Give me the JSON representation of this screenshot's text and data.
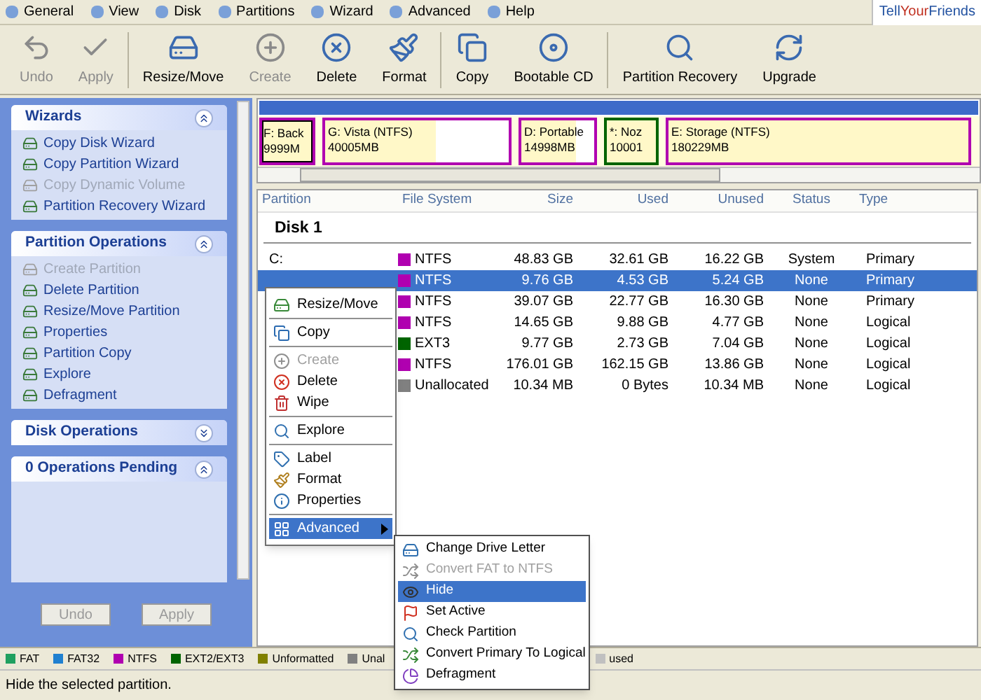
{
  "menu_bar": {
    "items": [
      "General",
      "View",
      "Disk",
      "Partitions",
      "Wizard",
      "Advanced",
      "Help"
    ],
    "link": [
      "Tell ",
      "Your ",
      "Friends"
    ]
  },
  "toolbar": {
    "groups": [
      [
        {
          "label": "Undo",
          "kind": "undo",
          "disabled": true
        },
        {
          "label": "Apply",
          "kind": "apply",
          "disabled": true
        }
      ],
      [
        {
          "label": "Resize/Move",
          "kind": "resize",
          "disabled": false
        },
        {
          "label": "Create",
          "kind": "create",
          "disabled": true
        },
        {
          "label": "Delete",
          "kind": "delete",
          "disabled": false
        },
        {
          "label": "Format",
          "kind": "format",
          "disabled": false
        }
      ],
      [
        {
          "label": "Copy",
          "kind": "copy",
          "disabled": false
        },
        {
          "label": "Bootable CD",
          "kind": "cd",
          "disabled": false
        }
      ],
      [
        {
          "label": "Partition Recovery",
          "kind": "recovery",
          "disabled": false
        },
        {
          "label": "Upgrade",
          "kind": "upgrade",
          "disabled": false
        }
      ]
    ]
  },
  "sidebar": {
    "panels": [
      {
        "title": "Wizards",
        "expanded": true,
        "items": [
          {
            "label": "Copy Disk Wizard",
            "disabled": false
          },
          {
            "label": "Copy Partition Wizard",
            "disabled": false
          },
          {
            "label": "Copy Dynamic Volume",
            "disabled": true
          },
          {
            "label": "Partition Recovery Wizard",
            "disabled": false
          }
        ]
      },
      {
        "title": "Partition Operations",
        "expanded": true,
        "items": [
          {
            "label": "Create Partition",
            "disabled": true
          },
          {
            "label": "Delete Partition",
            "disabled": false
          },
          {
            "label": "Resize/Move Partition",
            "disabled": false
          },
          {
            "label": "Properties",
            "disabled": false
          },
          {
            "label": "Partition Copy",
            "disabled": false
          },
          {
            "label": "Explore",
            "disabled": false
          },
          {
            "label": "Defragment",
            "disabled": false
          }
        ]
      },
      {
        "title": "Disk Operations",
        "expanded": false
      },
      {
        "title": "0 Operations Pending",
        "expanded": true
      }
    ],
    "buttons": [
      {
        "label": "Undo",
        "disabled": true
      },
      {
        "label": "Apply",
        "disabled": true
      }
    ]
  },
  "disk_map": {
    "partitions": [
      {
        "name": "F: Back",
        "size": "9999M",
        "color": "#b000b0",
        "selected": true,
        "level": 1
      },
      {
        "name": "G: Vista (NTFS)",
        "size": "40005MB",
        "color": "#b000b0",
        "selected": false,
        "level": 0.6
      },
      {
        "name": "D: Portable",
        "size": "14998MB",
        "color": "#b000b0",
        "selected": false,
        "level": 0.75
      },
      {
        "name": "*: Noz",
        "size": "10001",
        "color": "#006400",
        "selected": false,
        "level": 1
      },
      {
        "name": "E: Storage (NTFS)",
        "size": "180229MB",
        "color": "#b000b0",
        "selected": false,
        "level": 1
      }
    ]
  },
  "table": {
    "columns": [
      "Partition",
      "File System",
      "Size",
      "Used",
      "Unused",
      "Status",
      "Type"
    ],
    "group": "Disk 1",
    "rows": [
      {
        "partition": "C:",
        "file_system": "NTFS",
        "color": "#b000b0",
        "size": "48.83 GB",
        "used": "32.61 GB",
        "unused": "16.22 GB",
        "status": "System",
        "type": "Primary",
        "selected": false
      },
      {
        "file_system": "NTFS",
        "color": "#b000b0",
        "size": "9.76 GB",
        "used": "4.53 GB",
        "unused": "5.24 GB",
        "status": "None",
        "type": "Primary",
        "selected": true
      },
      {
        "file_system": "NTFS",
        "color": "#b000b0",
        "size": "39.07 GB",
        "used": "22.77 GB",
        "unused": "16.30 GB",
        "status": "None",
        "type": "Primary",
        "selected": false
      },
      {
        "file_system": "NTFS",
        "color": "#b000b0",
        "size": "14.65 GB",
        "used": "9.88 GB",
        "unused": "4.77 GB",
        "status": "None",
        "type": "Logical",
        "selected": false
      },
      {
        "file_system": "EXT3",
        "color": "#006400",
        "size": "9.77 GB",
        "used": "2.73 GB",
        "unused": "7.04 GB",
        "status": "None",
        "type": "Logical",
        "selected": false
      },
      {
        "file_system": "NTFS",
        "color": "#b000b0",
        "size": "176.01 GB",
        "used": "162.15 GB",
        "unused": "13.86 GB",
        "status": "None",
        "type": "Logical",
        "selected": false
      },
      {
        "file_system": "Unallocated",
        "color": "#808080",
        "size": "10.34 MB",
        "used": "0 Bytes",
        "unused": "10.34 MB",
        "status": "None",
        "type": "Logical",
        "selected": false
      }
    ]
  },
  "context_menu": {
    "sections": [
      [
        {
          "label": "Resize/Move",
          "kind": "resize",
          "disabled": false,
          "selected": false
        }
      ],
      [
        {
          "label": "Copy",
          "kind": "copy",
          "disabled": false,
          "selected": false
        }
      ],
      [
        {
          "label": "Create",
          "kind": "create",
          "disabled": true,
          "selected": false
        },
        {
          "label": "Delete",
          "kind": "delete",
          "disabled": false,
          "selected": false
        },
        {
          "label": "Wipe",
          "kind": "wipe",
          "disabled": false,
          "selected": false
        }
      ],
      [
        {
          "label": "Explore",
          "kind": "explore",
          "disabled": false,
          "selected": false
        }
      ],
      [
        {
          "label": "Label",
          "kind": "label",
          "disabled": false,
          "selected": false
        },
        {
          "label": "Format",
          "kind": "format",
          "disabled": false,
          "selected": false
        },
        {
          "label": "Properties",
          "kind": "properties",
          "disabled": false,
          "selected": false
        }
      ],
      [
        {
          "label": "Advanced",
          "kind": "advanced",
          "selected": true,
          "submenu": true
        }
      ]
    ]
  },
  "submenu": {
    "items": [
      {
        "label": "Change Drive Letter",
        "kind": "letter",
        "disabled": false,
        "selected": false
      },
      {
        "label": "Convert FAT to NTFS",
        "kind": "convert",
        "disabled": true,
        "selected": false
      },
      {
        "label": "Hide",
        "kind": "hide",
        "disabled": false,
        "selected": true
      },
      {
        "label": "Set Active",
        "kind": "active",
        "disabled": false,
        "selected": false
      },
      {
        "label": "Check Partition",
        "kind": "check",
        "disabled": false,
        "selected": false
      },
      {
        "label": "Convert Primary To Logical",
        "kind": "convert2",
        "disabled": false,
        "selected": false
      },
      {
        "label": "Defragment",
        "kind": "defrag",
        "disabled": false,
        "selected": false
      }
    ]
  },
  "legend": [
    {
      "label": "FAT",
      "color": "#20a060"
    },
    {
      "label": "FAT32",
      "color": "#2080d0"
    },
    {
      "label": "NTFS",
      "color": "#b000b0"
    },
    {
      "label": "EXT2/EXT3",
      "color": "#006400"
    },
    {
      "label": "Unformatted",
      "color": "#808000"
    },
    {
      "label": "Unal",
      "color": "#808080"
    },
    {
      "label": "used",
      "color": "#c0c0c0"
    }
  ],
  "status_bar": "Hide the selected partition."
}
